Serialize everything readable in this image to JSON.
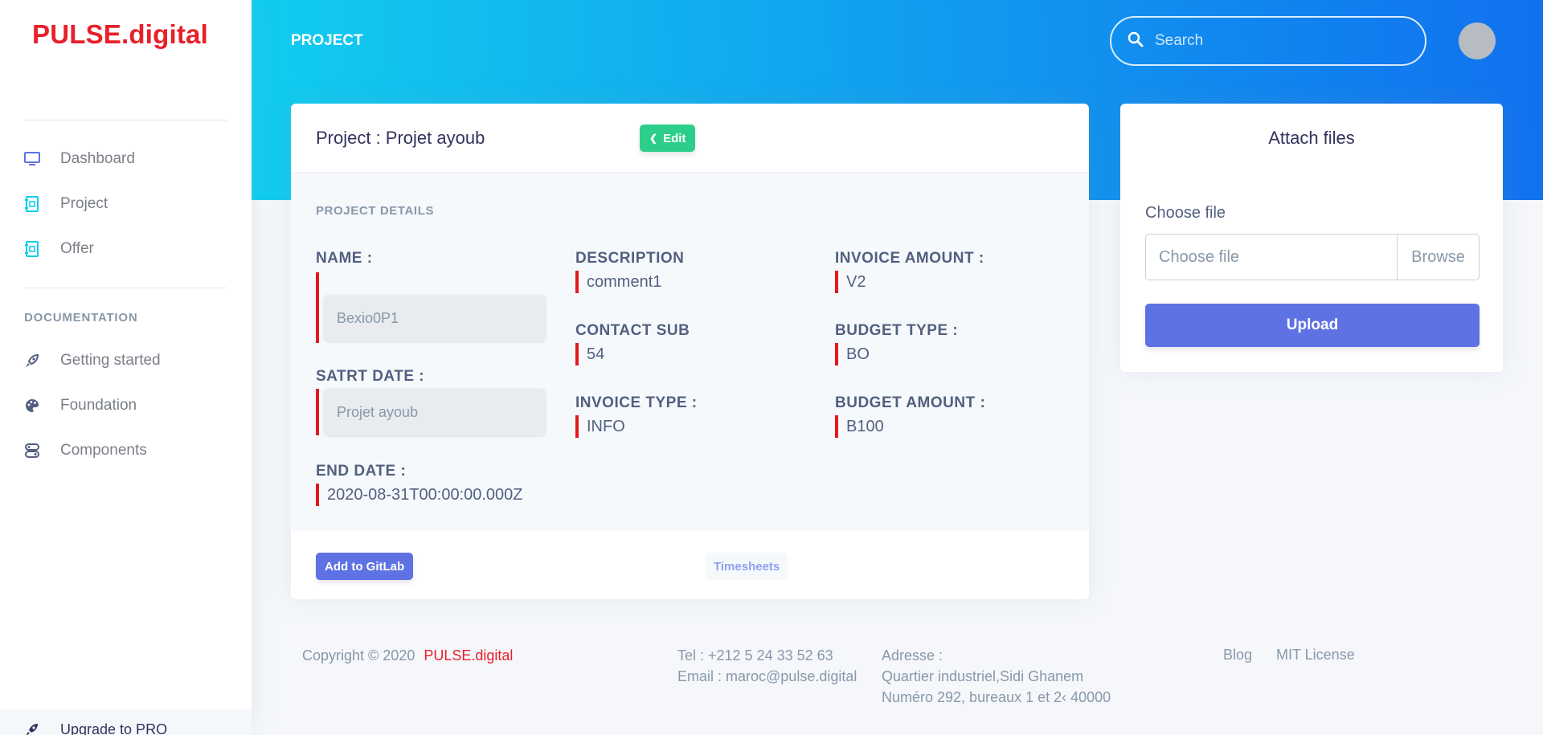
{
  "sidebar": {
    "brand": "PULSE.digital",
    "nav": [
      {
        "label": "Dashboard",
        "icon": "monitor-icon"
      },
      {
        "label": "Project",
        "icon": "project-icon"
      },
      {
        "label": "Offer",
        "icon": "offer-icon"
      }
    ],
    "doc_section_title": "DOCUMENTATION",
    "docs": [
      {
        "label": "Getting started",
        "icon": "rocket-icon"
      },
      {
        "label": "Foundation",
        "icon": "palette-icon"
      },
      {
        "label": "Components",
        "icon": "components-icon"
      }
    ],
    "upgrade_label": "Upgrade to PRO"
  },
  "header": {
    "page_tag": "PROJECT",
    "search_placeholder": "Search"
  },
  "project": {
    "title": "Project : Projet ayoub",
    "edit_label": "Edit",
    "details_title": "PROJECT DETAILS",
    "name_label": "NAME :",
    "name_placeholder": "Bexio0P1",
    "start_label": "SATRT DATE :",
    "start_placeholder": "Projet ayoub",
    "end_label": "END DATE :",
    "end_value": "2020-08-31T00:00:00.000Z",
    "description_label": "DESCRIPTION",
    "description_value": "comment1",
    "contact_label": "CONTACT SUB",
    "contact_value": "54",
    "invoice_type_label": "INVOICE TYPE :",
    "invoice_type_value": "INFO",
    "invoice_amount_label": "INVOICE AMOUNT :",
    "invoice_amount_value": "V2",
    "budget_type_label": "BUDGET TYPE :",
    "budget_type_value": "BO",
    "budget_amount_label": "BUDGET AMOUNT :",
    "budget_amount_value": "B100",
    "gitlab_label": "Add to GitLab",
    "timesheets_label": "Timesheets"
  },
  "attach": {
    "title": "Attach files",
    "choose_label": "Choose file",
    "file_placeholder": "Choose file",
    "browse_label": "Browse",
    "upload_label": "Upload"
  },
  "footer": {
    "copyright": "Copyright © 2020",
    "brand": "PULSE.digital",
    "tel": "Tel : +212 5 24 33 52 63",
    "email": "Email : maroc@pulse.digital",
    "address_label": "Adresse :",
    "address_line1": "Quartier industriel,Sidi Ghanem",
    "address_line2": "Numéro 292, bureaux 1 et 2‹ 40000",
    "links": [
      "Blog",
      "MIT License"
    ]
  },
  "colors": {
    "brand_red": "#e8202a",
    "header_gradient_start": "#11cdef",
    "header_gradient_end": "#1171ef",
    "primary": "#5e72e4",
    "success": "#2dce89",
    "field_marker": "#e3191f"
  }
}
